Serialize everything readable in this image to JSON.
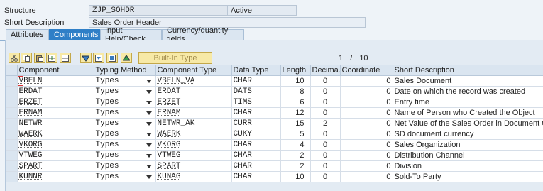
{
  "header": {
    "structure_label": "Structure",
    "structure_value": "ZJP_SOHDR",
    "status": "Active",
    "short_desc_label": "Short Description",
    "short_desc_value": "Sales Order Header"
  },
  "tabs": [
    {
      "label": "Attributes",
      "active": false
    },
    {
      "label": "Components",
      "active": true
    },
    {
      "label": "Input Help/Check",
      "active": false
    },
    {
      "label": "Currency/quantity fields",
      "active": false
    }
  ],
  "toolbar": {
    "icons": [
      "cut-icon",
      "copy-icon",
      "paste-icon",
      "insert-row-icon",
      "delete-row-icon",
      "find-icon",
      "find-next-icon",
      "details-icon",
      "top-icon"
    ],
    "builtin_label": "Built-In Type",
    "pager_current": "1",
    "pager_sep": "/",
    "pager_total": "10"
  },
  "columns": [
    "Component",
    "Typing Method",
    "Component Type",
    "Data Type",
    "Length",
    "Decima...",
    "Coordinate",
    "Short Description"
  ],
  "rows": [
    {
      "component": "VBELN",
      "typing": "Types",
      "ctype": "VBELN_VA",
      "dtype": "CHAR",
      "length": "10",
      "decimals": "0",
      "coord": "0",
      "desc": "Sales Document"
    },
    {
      "component": "ERDAT",
      "typing": "Types",
      "ctype": "ERDAT",
      "dtype": "DATS",
      "length": "8",
      "decimals": "0",
      "coord": "0",
      "desc": "Date on which the record was created"
    },
    {
      "component": "ERZET",
      "typing": "Types",
      "ctype": "ERZET",
      "dtype": "TIMS",
      "length": "6",
      "decimals": "0",
      "coord": "0",
      "desc": "Entry time"
    },
    {
      "component": "ERNAM",
      "typing": "Types",
      "ctype": "ERNAM",
      "dtype": "CHAR",
      "length": "12",
      "decimals": "0",
      "coord": "0",
      "desc": "Name of Person who Created the Object"
    },
    {
      "component": "NETWR",
      "typing": "Types",
      "ctype": "NETWR_AK",
      "dtype": "CURR",
      "length": "15",
      "decimals": "2",
      "coord": "0",
      "desc": "Net Value of the Sales Order in Document Currency"
    },
    {
      "component": "WAERK",
      "typing": "Types",
      "ctype": "WAERK",
      "dtype": "CUKY",
      "length": "5",
      "decimals": "0",
      "coord": "0",
      "desc": "SD document currency"
    },
    {
      "component": "VKORG",
      "typing": "Types",
      "ctype": "VKORG",
      "dtype": "CHAR",
      "length": "4",
      "decimals": "0",
      "coord": "0",
      "desc": "Sales Organization"
    },
    {
      "component": "VTWEG",
      "typing": "Types",
      "ctype": "VTWEG",
      "dtype": "CHAR",
      "length": "2",
      "decimals": "0",
      "coord": "0",
      "desc": "Distribution Channel"
    },
    {
      "component": "SPART",
      "typing": "Types",
      "ctype": "SPART",
      "dtype": "CHAR",
      "length": "2",
      "decimals": "0",
      "coord": "0",
      "desc": "Division"
    },
    {
      "component": "KUNNR",
      "typing": "Types",
      "ctype": "KUNAG",
      "dtype": "CHAR",
      "length": "10",
      "decimals": "0",
      "coord": "0",
      "desc": "Sold-To Party"
    }
  ]
}
